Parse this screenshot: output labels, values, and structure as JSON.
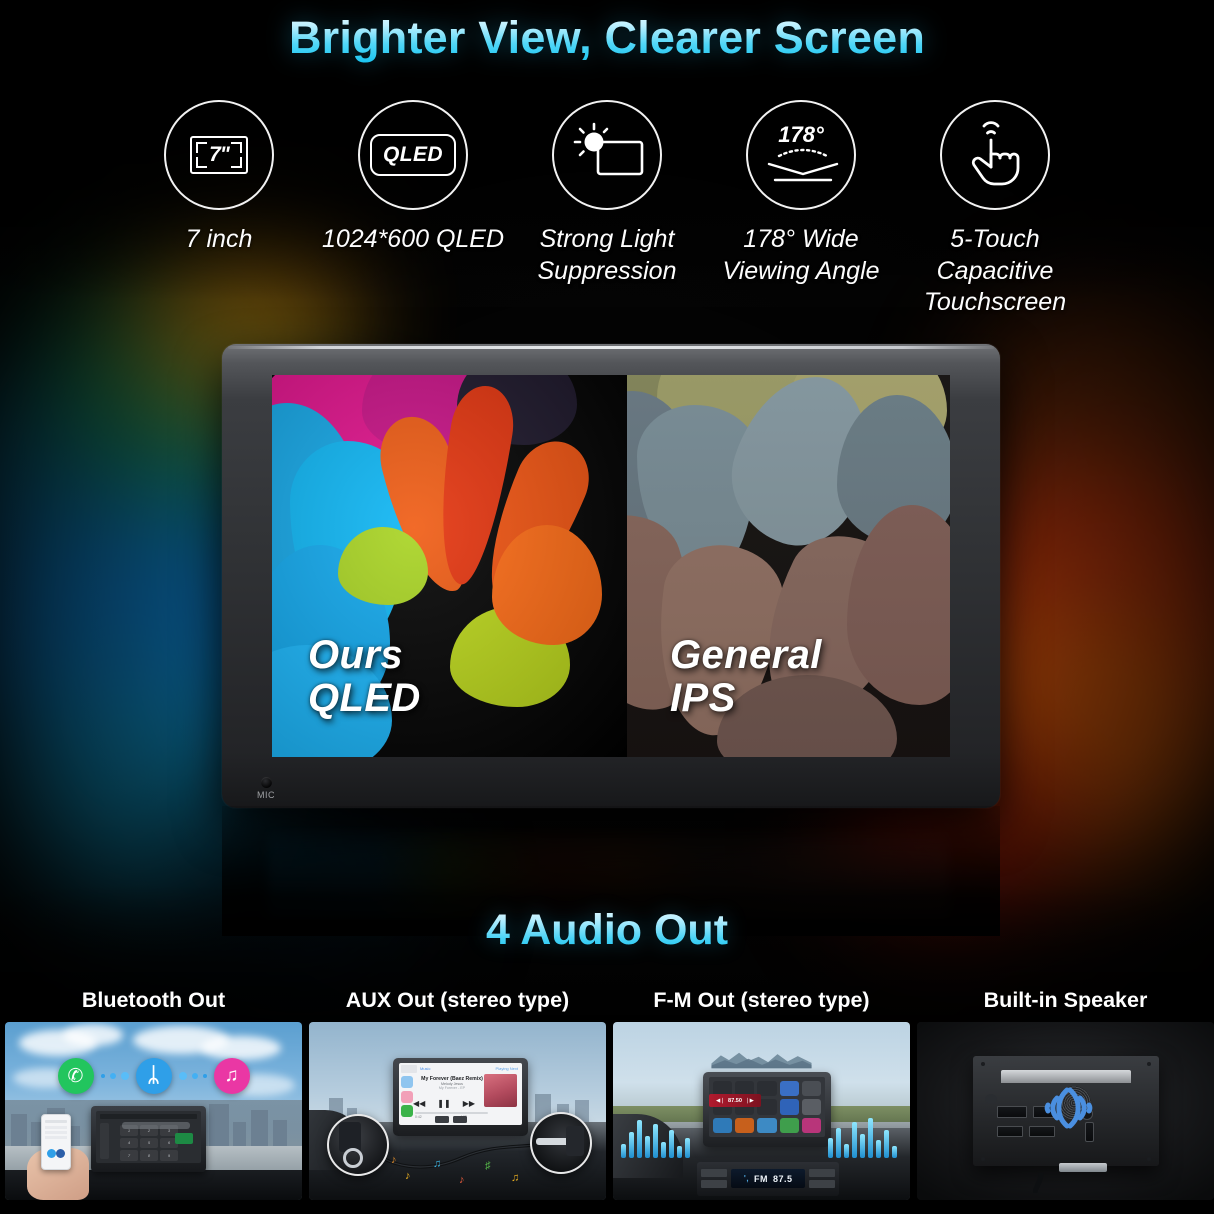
{
  "headline": "Brighter View, Clearer Screen",
  "features": [
    {
      "icon": "screen-size-icon",
      "icon_text": "7\"",
      "label": "7 inch"
    },
    {
      "icon": "qled-badge-icon",
      "icon_text": "QLED",
      "label": "1024*600 QLED"
    },
    {
      "icon": "sun-screen-icon",
      "icon_text": "",
      "label": "Strong Light\nSuppression"
    },
    {
      "icon": "viewing-angle-icon",
      "icon_text": "178°",
      "label": "178° Wide\nViewing Angle"
    },
    {
      "icon": "touch-hand-icon",
      "icon_text": "",
      "label": "5-Touch Capacitive\nTouchscreen"
    }
  ],
  "device": {
    "comparison_left": "Ours\nQLED",
    "comparison_right": "General\nIPS",
    "mic_label": "MIC"
  },
  "audio": {
    "title": "4 Audio Out",
    "cards": [
      {
        "title": "Bluetooth Out",
        "icons": [
          "phone-call-icon",
          "bluetooth-icon",
          "music-note-icon"
        ],
        "icon_glyphs": [
          "✆",
          "ᛦ",
          "♫"
        ],
        "icon_colors": [
          "#22c55e",
          "#2f9fe8",
          "#ea37a4"
        ],
        "keypad": [
          "1",
          "2",
          "3",
          "4",
          "5",
          "6",
          "7",
          "8",
          "9",
          "*",
          "0",
          "#"
        ]
      },
      {
        "title": "AUX Out (stereo type)",
        "now_playing_title": "My Forever (Baez Remix)",
        "now_playing_artist": "Melody Jesus",
        "now_playing_album": "My Forever - EP",
        "playing_next_label": "Playing Next",
        "source_label": "Music",
        "elapsed": "0:42",
        "remaining": "-4:08"
      },
      {
        "title": "F-M Out (stereo type)",
        "stereo_frequency": "87.50",
        "radio_band": "FM",
        "radio_frequency": "87.5"
      },
      {
        "title": "Built-in Speaker"
      }
    ]
  },
  "colors": {
    "accent_cyan": "#12c0ef",
    "accent_light": "#eafcff",
    "bezel": "#303235",
    "wave_blue": "#4a8fe0",
    "bluetooth_blue": "#2f9fe8",
    "call_green": "#22c55e",
    "music_pink": "#ea37a4"
  }
}
